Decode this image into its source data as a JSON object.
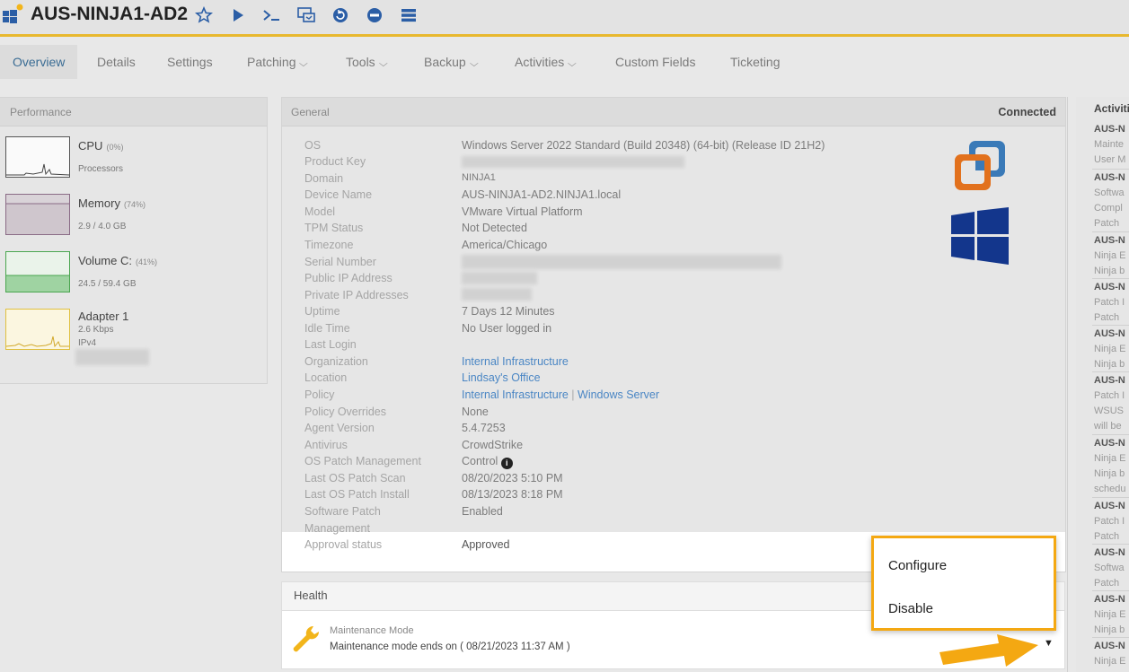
{
  "header": {
    "device_name": "AUS-NINJA1-AD2",
    "icons": [
      "windows-logo-icon",
      "favorite-star-icon",
      "run-script-icon",
      "terminal-icon",
      "remote-desktop-icon",
      "restart-icon",
      "shutdown-icon",
      "menu-icon"
    ]
  },
  "tabs": [
    {
      "label": "Overview",
      "active": true
    },
    {
      "label": "Details"
    },
    {
      "label": "Settings"
    },
    {
      "label": "Patching",
      "dropdown": true
    },
    {
      "label": "Tools",
      "dropdown": true
    },
    {
      "label": "Backup",
      "dropdown": true
    },
    {
      "label": "Activities",
      "dropdown": true
    },
    {
      "label": "Custom Fields"
    },
    {
      "label": "Ticketing"
    }
  ],
  "performance": {
    "title": "Performance",
    "cpu": {
      "name": "CPU",
      "pct": "(0%)",
      "sub": "Processors"
    },
    "memory": {
      "name": "Memory",
      "pct": "(74%)",
      "sub": "2.9 / 4.0 GB"
    },
    "volume": {
      "name": "Volume C:",
      "pct": "(41%)",
      "sub": "24.5 / 59.4 GB"
    },
    "adapter": {
      "name": "Adapter 1",
      "sub": "2.6 Kbps",
      "sub2": "IPv4"
    }
  },
  "general": {
    "title": "General",
    "status": "Connected",
    "labels": {
      "os": "OS",
      "product_key": "Product Key",
      "domain": "Domain",
      "device_name": "Device Name",
      "model": "Model",
      "tpm": "TPM Status",
      "timezone": "Timezone",
      "serial": "Serial Number",
      "public_ip": "Public IP Address",
      "private_ip": "Private IP Addresses",
      "uptime": "Uptime",
      "idle": "Idle Time",
      "last_login": "Last Login",
      "organization": "Organization",
      "location": "Location",
      "policy": "Policy",
      "policy_overrides": "Policy Overrides",
      "agent_version": "Agent Version",
      "antivirus": "Antivirus",
      "os_patch_mgmt": "OS Patch Management",
      "last_scan": "Last OS Patch Scan",
      "last_install": "Last OS Patch Install",
      "sw_patch_1": "Software Patch",
      "sw_patch_2": "Management",
      "approval": "Approval status"
    },
    "values": {
      "os": "Windows Server 2022 Standard (Build 20348) (64-bit) (Release ID 21H2)",
      "domain": "NINJA1",
      "device_name": "AUS-NINJA1-AD2.NINJA1.local",
      "model": "VMware Virtual Platform",
      "tpm": "Not Detected",
      "timezone": "America/Chicago",
      "uptime": "7 Days 12 Minutes",
      "idle": "No User logged in",
      "organization": "Internal Infrastructure",
      "location": "Lindsay's Office",
      "policy_1": "Internal Infrastructure",
      "policy_sep": "|",
      "policy_2": "Windows Server",
      "policy_overrides": "None",
      "agent_version": "5.4.7253",
      "antivirus": "CrowdStrike",
      "os_patch_mgmt": "Control",
      "last_scan": "08/20/2023 5:10 PM",
      "last_install": "08/13/2023 8:18 PM",
      "sw_patch": "Enabled",
      "approval": "Approved"
    }
  },
  "health": {
    "title": "Health",
    "item_title": "Maintenance Mode",
    "item_text": "Maintenance mode ends on ( 08/21/2023 11:37 AM )"
  },
  "menu": {
    "configure": "Configure",
    "disable": "Disable"
  },
  "activities": {
    "title": "Activiti",
    "items": [
      {
        "t": "AUS-N",
        "l": [
          "Mainte",
          "User M"
        ]
      },
      {
        "t": "AUS-N",
        "l": [
          "Softwa",
          "Compl",
          "Patch"
        ]
      },
      {
        "t": "AUS-N",
        "l": [
          "Ninja E",
          "Ninja b"
        ]
      },
      {
        "t": "AUS-N",
        "l": [
          "Patch I",
          "Patch"
        ]
      },
      {
        "t": "AUS-N",
        "l": [
          "Ninja E",
          "Ninja b"
        ]
      },
      {
        "t": "AUS-N",
        "l": [
          "Patch I",
          "WSUS",
          "will be"
        ]
      },
      {
        "t": "AUS-N",
        "l": [
          "Ninja E",
          "Ninja b",
          "schedu"
        ]
      },
      {
        "t": "AUS-N",
        "l": [
          "Patch I",
          "Patch"
        ]
      },
      {
        "t": "AUS-N",
        "l": [
          "Softwa",
          "Patch"
        ]
      },
      {
        "t": "AUS-N",
        "l": [
          "Ninja E",
          "Ninja b"
        ]
      },
      {
        "t": "AUS-N",
        "l": [
          "Ninja E"
        ]
      }
    ]
  },
  "colors": {
    "accent": "#e8b82e",
    "link": "#4a86c4",
    "highlight": "#f4a812"
  }
}
